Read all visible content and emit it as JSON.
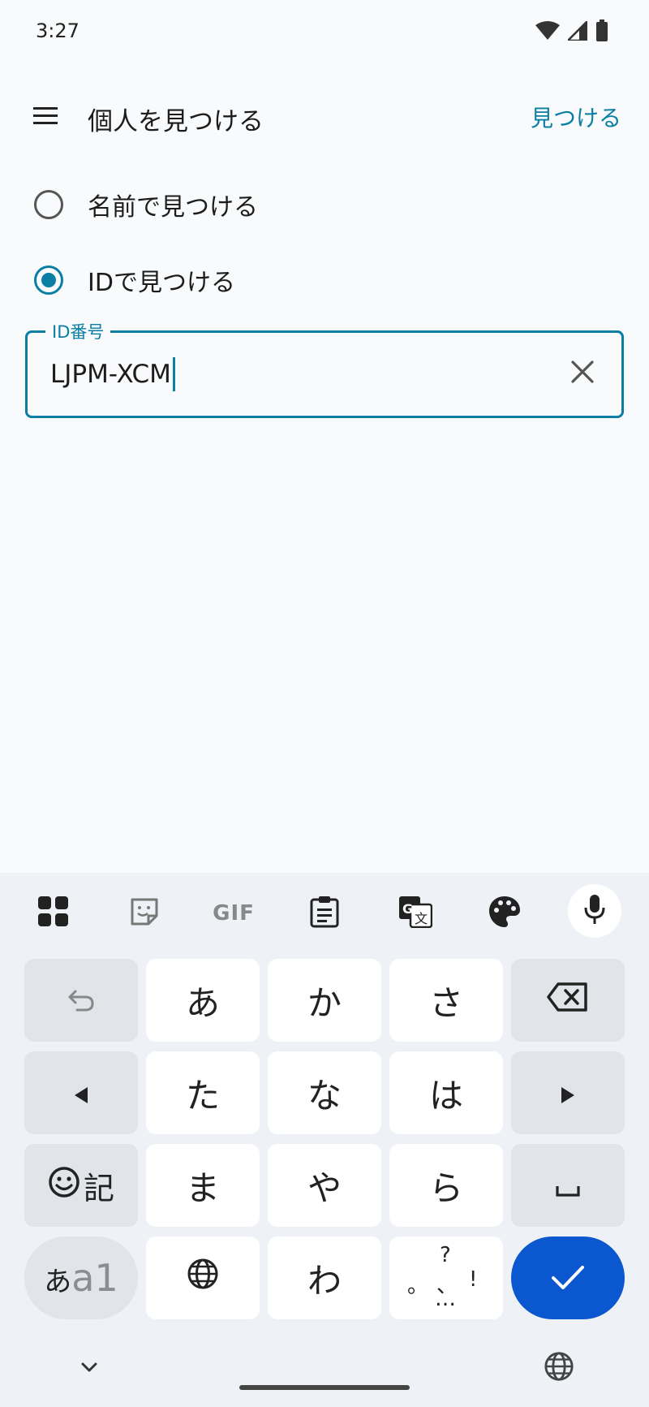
{
  "status_bar": {
    "time": "3:27",
    "icons": [
      "wifi-icon",
      "signal-icon",
      "battery-icon"
    ]
  },
  "app_bar": {
    "menu_icon": "menu-icon",
    "title": "個人を見つける",
    "action_label": "見つける"
  },
  "search_mode": {
    "options": [
      {
        "label": "名前で見つける",
        "checked": false
      },
      {
        "label": "IDで見つける",
        "checked": true
      }
    ]
  },
  "id_field": {
    "label": "ID番号",
    "value": "LJPM-XCM",
    "clear_icon": "close-icon"
  },
  "keyboard": {
    "toolbar": [
      "apps-grid-icon",
      "sticker-icon",
      "gif-icon",
      "clipboard-icon",
      "translate-icon",
      "palette-icon",
      "mic-icon"
    ],
    "gif_label": "GIF",
    "rows": [
      [
        "あ",
        "か",
        "さ"
      ],
      [
        "た",
        "な",
        "は"
      ],
      [
        "ま",
        "や",
        "ら"
      ],
      [
        "わ"
      ]
    ],
    "kigou_label": "記",
    "mode_label_kana": "あ",
    "mode_label_alpha": "a1",
    "punct": {
      "top": "?",
      "left": "。",
      "middle": "、",
      "right": "!",
      "bottom": "…"
    },
    "colors": {
      "accent": "#0a7fa3",
      "enter": "#0b57d0"
    }
  }
}
